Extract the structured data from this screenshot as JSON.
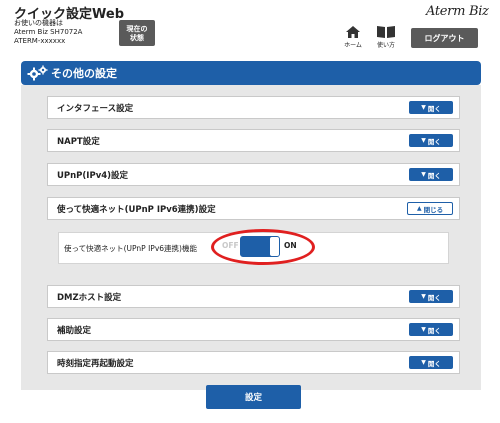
{
  "header": {
    "app_title": "クイック設定Web",
    "device_info_line1": "お使いの機器は",
    "device_info_line2": "Aterm Biz SH7072A",
    "device_info_line3": "ATERM-xxxxxx",
    "status_button_line1": "現在の",
    "status_button_line2": "状態",
    "brand_logo": "Aterm Biz",
    "home_icon": "home-icon",
    "home_label": "ホーム",
    "manual_icon": "book-icon",
    "manual_label": "使い方",
    "logout_label": "ログアウト"
  },
  "section": {
    "icon": "gear-icon",
    "title": "その他の設定"
  },
  "rows": [
    {
      "label": "インタフェース設定",
      "button": "開く"
    },
    {
      "label": "NAPT設定",
      "button": "開く"
    },
    {
      "label": "UPnP(IPv4)設定",
      "button": "開く"
    },
    {
      "label": "使って快適ネット(UPnP IPv6連携)設定",
      "button": "閉じる"
    },
    {
      "label": "DMZホスト設定",
      "button": "開く"
    },
    {
      "label": "補助設定",
      "button": "開く"
    },
    {
      "label": "時刻指定再起動設定",
      "button": "開く"
    }
  ],
  "expanded": {
    "label": "使って快適ネット(UPnP IPv6連携)機能",
    "toggle_off": "OFF",
    "toggle_on": "ON",
    "toggle_state": "ON"
  },
  "submit_label": "設定",
  "colors": {
    "primary": "#1e5fa8",
    "header_button": "#5a5a5a",
    "panel_bg": "#e7e7e7",
    "highlight_ring": "#e02020"
  }
}
